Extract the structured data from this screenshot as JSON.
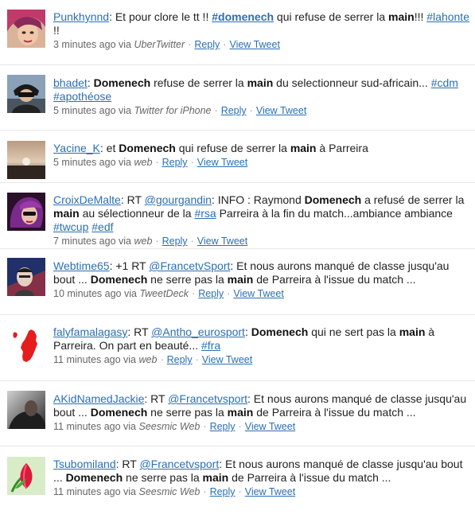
{
  "tweets": [
    {
      "user": "Punkhynnd",
      "segments": [
        {
          "t": "text",
          "v": ": Et pour clore le tt !! "
        },
        {
          "t": "hash-bold",
          "v": "#domenech"
        },
        {
          "t": "text",
          "v": " qui refuse de serrer la "
        },
        {
          "t": "bold",
          "v": "main"
        },
        {
          "t": "text",
          "v": "!!! "
        },
        {
          "t": "link",
          "v": "#lahonte"
        },
        {
          "t": "text",
          "v": " !!"
        }
      ],
      "time": "3 minutes ago",
      "via": "via",
      "source": "UberTwitter",
      "reply": "Reply",
      "view": "View Tweet",
      "avatar": "avatar-punkhynnd"
    },
    {
      "user": "bhadet",
      "segments": [
        {
          "t": "text",
          "v": ": "
        },
        {
          "t": "bold",
          "v": "Domenech"
        },
        {
          "t": "text",
          "v": " refuse de serrer la "
        },
        {
          "t": "bold",
          "v": "main"
        },
        {
          "t": "text",
          "v": " du selectionneur sud-africain... "
        },
        {
          "t": "link",
          "v": "#cdm"
        },
        {
          "t": "text",
          "v": " "
        },
        {
          "t": "link",
          "v": "#apothéose"
        }
      ],
      "time": "5 minutes ago",
      "via": "via",
      "source": "Twitter for iPhone",
      "reply": "Reply",
      "view": "View Tweet",
      "avatar": "avatar-bhadet"
    },
    {
      "user": "Yacine_K",
      "segments": [
        {
          "t": "text",
          "v": ": et "
        },
        {
          "t": "bold",
          "v": "Domenech"
        },
        {
          "t": "text",
          "v": " qui refuse de serrer la "
        },
        {
          "t": "bold",
          "v": "main"
        },
        {
          "t": "text",
          "v": " à Parreira"
        }
      ],
      "time": "5 minutes ago",
      "via": "via",
      "source": "web",
      "reply": "Reply",
      "view": "View Tweet",
      "avatar": "avatar-yacine"
    },
    {
      "user": "CroixDeMalte",
      "segments": [
        {
          "t": "text",
          "v": ": RT "
        },
        {
          "t": "link",
          "v": "@gourgandin"
        },
        {
          "t": "text",
          "v": ": INFO : Raymond "
        },
        {
          "t": "bold",
          "v": "Domenech"
        },
        {
          "t": "text",
          "v": " a refusé de serrer la "
        },
        {
          "t": "bold",
          "v": "main"
        },
        {
          "t": "text",
          "v": " au sélectionneur de la "
        },
        {
          "t": "link",
          "v": "#rsa"
        },
        {
          "t": "text",
          "v": " Parreira à la fin du match...ambiance ambiance "
        },
        {
          "t": "link",
          "v": "#twcup"
        },
        {
          "t": "text",
          "v": " "
        },
        {
          "t": "link",
          "v": "#edf"
        }
      ],
      "time": "7 minutes ago",
      "via": "via",
      "source": "web",
      "reply": "Reply",
      "view": "View Tweet",
      "avatar": "avatar-croixdemalte"
    },
    {
      "user": "Webtime65",
      "segments": [
        {
          "t": "text",
          "v": ": +1 RT "
        },
        {
          "t": "link",
          "v": "@FrancetvSport"
        },
        {
          "t": "text",
          "v": ": Et nous aurons manqué de classe jusqu'au bout ... "
        },
        {
          "t": "bold",
          "v": "Domenech"
        },
        {
          "t": "text",
          "v": " ne serre pas la "
        },
        {
          "t": "bold",
          "v": "main"
        },
        {
          "t": "text",
          "v": " de Parreira à l'issue du match ..."
        }
      ],
      "time": "10 minutes ago",
      "via": "via",
      "source": "TweetDeck",
      "reply": "Reply",
      "view": "View Tweet",
      "avatar": "avatar-webtime"
    },
    {
      "user": "falyfamalagasy",
      "segments": [
        {
          "t": "text",
          "v": ": RT "
        },
        {
          "t": "link",
          "v": "@Antho_eurosport"
        },
        {
          "t": "text",
          "v": ": "
        },
        {
          "t": "bold",
          "v": "Domenech"
        },
        {
          "t": "text",
          "v": " qui ne sert pas la "
        },
        {
          "t": "bold",
          "v": "main"
        },
        {
          "t": "text",
          "v": " à Parreira. On part en beauté... "
        },
        {
          "t": "link",
          "v": "#fra"
        }
      ],
      "time": "11 minutes ago",
      "via": "via",
      "source": "web",
      "reply": "Reply",
      "view": "View Tweet",
      "avatar": "avatar-madagascar"
    },
    {
      "user": "AKidNamedJackie",
      "segments": [
        {
          "t": "text",
          "v": ": RT "
        },
        {
          "t": "link",
          "v": "@Francetvsport"
        },
        {
          "t": "text",
          "v": ": Et nous aurons manqué de classe jusqu'au bout ... "
        },
        {
          "t": "bold",
          "v": "Domenech"
        },
        {
          "t": "text",
          "v": " ne serre pas la "
        },
        {
          "t": "bold",
          "v": "main"
        },
        {
          "t": "text",
          "v": " de Parreira à l'issue du match ..."
        }
      ],
      "time": "11 minutes ago",
      "via": "via",
      "source": "Seesmic Web",
      "reply": "Reply",
      "view": "View Tweet",
      "avatar": "avatar-akid"
    },
    {
      "user": "Tsubomiland",
      "segments": [
        {
          "t": "text",
          "v": ": RT "
        },
        {
          "t": "link",
          "v": "@Francetvsport"
        },
        {
          "t": "text",
          "v": ": Et nous aurons manqué de classe jusqu'au bout ... "
        },
        {
          "t": "bold",
          "v": "Domenech"
        },
        {
          "t": "text",
          "v": " ne serre pas la "
        },
        {
          "t": "bold",
          "v": "main"
        },
        {
          "t": "text",
          "v": " de Parreira à l'issue du match ..."
        }
      ],
      "time": "11 minutes ago",
      "via": "via",
      "source": "Seesmic Web",
      "reply": "Reply",
      "view": "View Tweet",
      "avatar": "avatar-tsubomi"
    }
  ],
  "colors": {
    "link": "#2a6fb5",
    "meta": "#666666",
    "divider": "#e6e6e6"
  }
}
